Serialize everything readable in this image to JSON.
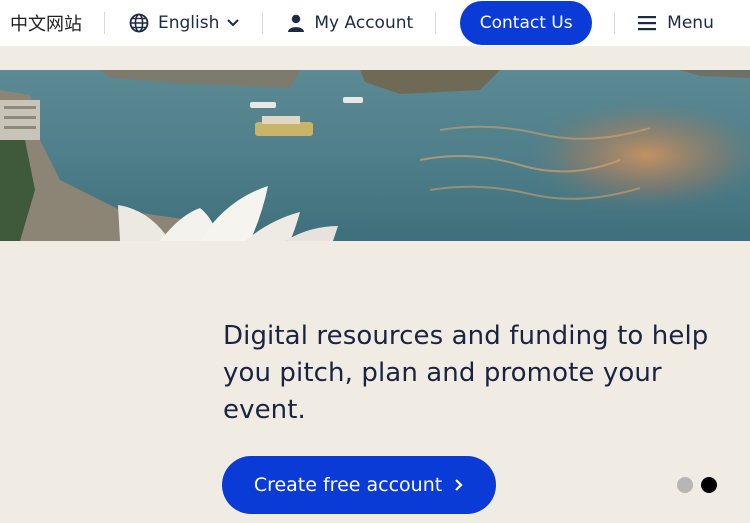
{
  "nav": {
    "chinese_site": "中文网站",
    "language": "English",
    "account": "My Account",
    "contact": "Contact Us",
    "menu": "Menu"
  },
  "hero": {
    "headline": "Digital resources and funding to help you pitch, plan and promote your event.",
    "cta_label": "Create free account"
  },
  "carousel": {
    "slide_count": 2,
    "active_index": 1
  },
  "colors": {
    "brand_blue": "#0a3bd6",
    "background": "#f0ebe3",
    "text_dark": "#1b2340"
  },
  "icons": [
    "globe-icon",
    "chevron-down-icon",
    "person-icon",
    "hamburger-icon",
    "chevron-right-icon"
  ]
}
